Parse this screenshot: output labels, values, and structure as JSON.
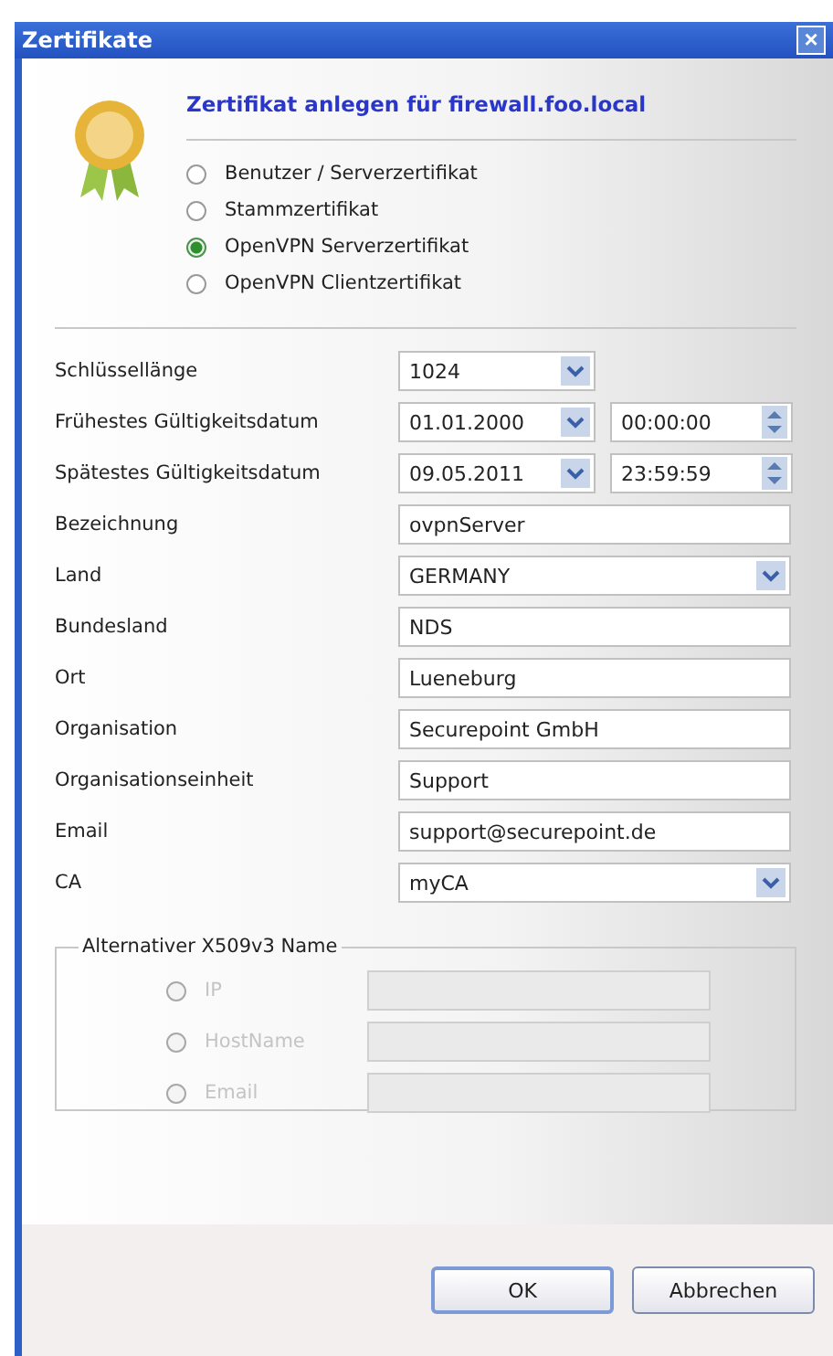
{
  "window": {
    "title": "Zertifikate",
    "close": "×"
  },
  "heading": "Zertifikat anlegen für firewall.foo.local",
  "cert_types": [
    {
      "label": "Benutzer / Serverzertifikat",
      "selected": false
    },
    {
      "label": "Stammzertifikat",
      "selected": false
    },
    {
      "label": "OpenVPN Serverzertifikat",
      "selected": true
    },
    {
      "label": "OpenVPN Clientzertifikat",
      "selected": false
    }
  ],
  "fields": [
    {
      "label": "Schlüssellänge",
      "kind": "short_combo",
      "value": "1024"
    },
    {
      "label": "Frühestes Gültigkeitsdatum",
      "kind": "date_time",
      "value": "01.01.2000",
      "time": "00:00:00"
    },
    {
      "label": "Spätestes Gültigkeitsdatum",
      "kind": "date_time",
      "value": "09.05.2011",
      "time": "23:59:59"
    },
    {
      "label": "Bezeichnung",
      "kind": "text",
      "value": "ovpnServer"
    },
    {
      "label": "Land",
      "kind": "combo",
      "value": "GERMANY"
    },
    {
      "label": "Bundesland",
      "kind": "text",
      "value": "NDS"
    },
    {
      "label": "Ort",
      "kind": "text",
      "value": "Lueneburg"
    },
    {
      "label": "Organisation",
      "kind": "text",
      "value": "Securepoint GmbH"
    },
    {
      "label": "Organisationseinheit",
      "kind": "text",
      "value": "Support"
    },
    {
      "label": "Email",
      "kind": "text",
      "value": "support@securepoint.de"
    },
    {
      "label": "CA",
      "kind": "combo",
      "value": "myCA"
    }
  ],
  "alt_name": {
    "title": "Alternativer X509v3 Name",
    "disabled": true,
    "options": [
      {
        "label": "IP",
        "selected": false
      },
      {
        "label": "HostName",
        "selected": false
      },
      {
        "label": "Email",
        "selected": false
      }
    ]
  },
  "buttons": [
    {
      "label": "OK",
      "default": true
    },
    {
      "label": "Abbrechen",
      "default": false
    }
  ]
}
